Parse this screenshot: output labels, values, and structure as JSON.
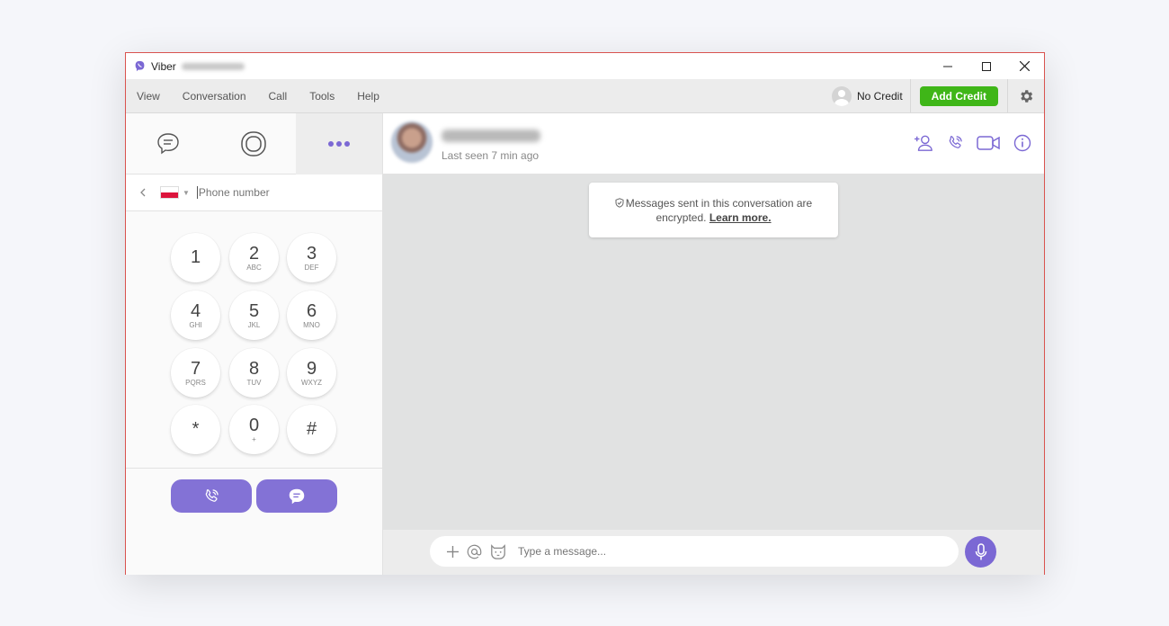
{
  "window": {
    "title": "Viber",
    "controls": [
      "minimize",
      "maximize",
      "close"
    ]
  },
  "menu": {
    "items": [
      "View",
      "Conversation",
      "Call",
      "Tools",
      "Help"
    ],
    "no_credit_label": "No Credit",
    "add_credit_label": "Add Credit"
  },
  "colors": {
    "accent": "#7b68d4",
    "add_credit": "#3fb618",
    "flag_red": "#dc143c"
  },
  "left_tabs": [
    {
      "icon": "chat-bubble-icon"
    },
    {
      "icon": "stories-icon"
    },
    {
      "icon": "more-dots-icon",
      "active": true
    }
  ],
  "dialer": {
    "country_flag": "Poland",
    "phone_placeholder": "Phone number",
    "keys": [
      {
        "digit": "1",
        "letters": ""
      },
      {
        "digit": "2",
        "letters": "ABC"
      },
      {
        "digit": "3",
        "letters": "DEF"
      },
      {
        "digit": "4",
        "letters": "GHI"
      },
      {
        "digit": "5",
        "letters": "JKL"
      },
      {
        "digit": "6",
        "letters": "MNO"
      },
      {
        "digit": "7",
        "letters": "PQRS"
      },
      {
        "digit": "8",
        "letters": "TUV"
      },
      {
        "digit": "9",
        "letters": "WXYZ"
      },
      {
        "digit": "*",
        "letters": ""
      },
      {
        "digit": "0",
        "letters": "+"
      },
      {
        "digit": "#",
        "letters": ""
      }
    ]
  },
  "chat": {
    "last_seen": "Last seen 7 min ago",
    "notice_text": "Messages sent in this conversation are encrypted.",
    "notice_link": "Learn more.",
    "message_placeholder": "Type a message..."
  }
}
